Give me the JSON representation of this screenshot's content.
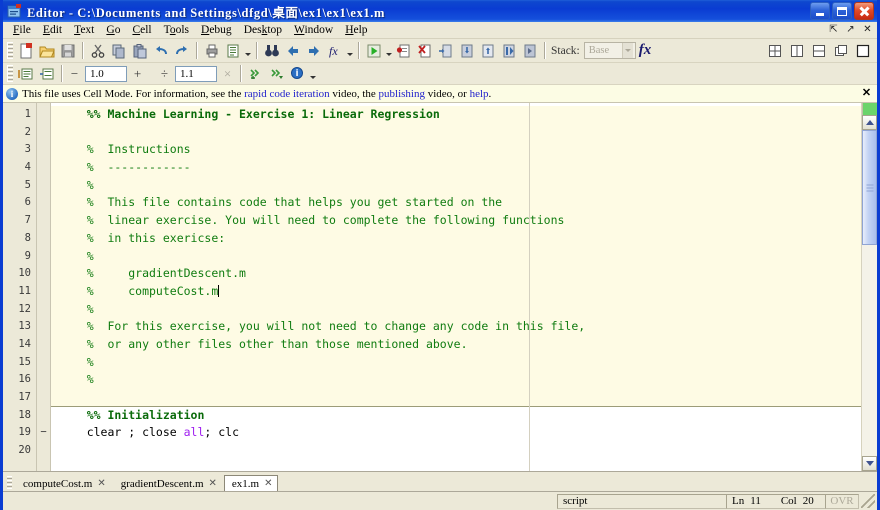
{
  "window": {
    "title": "Editor  -  C:\\Documents and Settings\\dfgd\\桌面\\ex1\\ex1\\ex1.m",
    "icon": "matlab-editor-icon",
    "minimize_label": "Minimize",
    "maximize_label": "Maximize",
    "close_label": "Close"
  },
  "menubar": {
    "items": [
      {
        "label": "File",
        "accel": "F"
      },
      {
        "label": "Edit",
        "accel": "E"
      },
      {
        "label": "Text",
        "accel": "T"
      },
      {
        "label": "Go",
        "accel": "G"
      },
      {
        "label": "Cell",
        "accel": "C"
      },
      {
        "label": "Tools",
        "accel": "o"
      },
      {
        "label": "Debug",
        "accel": "D"
      },
      {
        "label": "Desktop",
        "accel": "k"
      },
      {
        "label": "Window",
        "accel": "W"
      },
      {
        "label": "Help",
        "accel": "H"
      }
    ],
    "right_buttons": [
      {
        "name": "undock-icon",
        "glyph": "⇱"
      },
      {
        "name": "maximize-pane-icon",
        "glyph": "↗"
      },
      {
        "name": "close-pane-icon",
        "glyph": "✕"
      }
    ]
  },
  "toolbar": {
    "buttons": [
      {
        "name": "new-file-button",
        "icon": "new-document-icon"
      },
      {
        "name": "open-file-button",
        "icon": "open-folder-icon"
      },
      {
        "name": "save-file-button",
        "icon": "save-disk-icon"
      },
      {
        "name": "cut-button",
        "icon": "scissors-icon"
      },
      {
        "name": "copy-button",
        "icon": "copy-icon"
      },
      {
        "name": "paste-button",
        "icon": "paste-icon"
      },
      {
        "name": "undo-button",
        "icon": "undo-arrow-icon"
      },
      {
        "name": "redo-button",
        "icon": "redo-arrow-icon"
      },
      {
        "name": "print-button",
        "icon": "printer-icon"
      },
      {
        "name": "publish-button",
        "icon": "publish-page-icon"
      },
      {
        "name": "find-button",
        "icon": "binoculars-icon"
      },
      {
        "name": "back-button",
        "icon": "left-arrow-icon"
      },
      {
        "name": "forward-button",
        "icon": "right-arrow-icon"
      },
      {
        "name": "function-browser-button",
        "icon": "fx-icon"
      },
      {
        "name": "run-button",
        "icon": "green-play-icon"
      },
      {
        "name": "set-breakpoint-button",
        "icon": "breakpoint-icon"
      },
      {
        "name": "clear-breakpoints-button",
        "icon": "clear-breakpoint-icon"
      },
      {
        "name": "step-button",
        "icon": "step-icon"
      },
      {
        "name": "step-in-button",
        "icon": "step-in-icon"
      },
      {
        "name": "step-out-button",
        "icon": "step-out-icon"
      },
      {
        "name": "continue-button",
        "icon": "continue-icon"
      },
      {
        "name": "exit-debug-button",
        "icon": "exit-debug-icon"
      }
    ],
    "stack_label": "Stack:",
    "stack_value": "Base",
    "fx_label": "fx",
    "layout_buttons": [
      {
        "name": "tile-grid-button",
        "icon": "tile-grid-icon"
      },
      {
        "name": "tile-vertical-button",
        "icon": "tile-vertical-icon"
      },
      {
        "name": "tile-horizontal-button",
        "icon": "tile-horizontal-icon"
      },
      {
        "name": "float-button",
        "icon": "float-window-icon"
      },
      {
        "name": "single-pane-button",
        "icon": "single-pane-icon"
      }
    ]
  },
  "cell_toolbar": {
    "buttons": [
      {
        "name": "insert-cell-button",
        "icon": "insert-cell-icon"
      },
      {
        "name": "insert-cell-divider-button",
        "icon": "cell-divider-icon"
      },
      {
        "name": "evaluate-prev-cell-button",
        "icon": "eval-prev-cell-icon"
      },
      {
        "name": "evaluate-next-cell-button",
        "icon": "eval-next-cell-icon"
      },
      {
        "name": "cell-help-button",
        "icon": "info-circle-icon"
      }
    ],
    "decrement_label": "−",
    "increment_label": "+",
    "divide_label": "÷",
    "multiply_label": "×",
    "value_additive": "1.0",
    "value_multiplicative": "1.1"
  },
  "infobar": {
    "icon": "info-circle-icon",
    "prefix": "This file uses Cell Mode. For information, see the ",
    "link1": "rapid code iteration",
    "mid1": " video, the ",
    "link2": "publishing",
    "mid2": " video, or ",
    "link3": "help",
    "suffix": ".",
    "close_label": "✕"
  },
  "editor": {
    "column_marker_column": 75,
    "cursor": {
      "line": 11,
      "column": 20
    },
    "lines": [
      {
        "n": "1",
        "bp": "",
        "cell": true,
        "segments": [
          {
            "t": "    %% Machine Learning - Exercise 1: Linear Regression",
            "c": "cellhdr"
          }
        ]
      },
      {
        "n": "2",
        "bp": "",
        "cell": true,
        "segments": [
          {
            "t": "",
            "c": "cmt"
          }
        ]
      },
      {
        "n": "3",
        "bp": "",
        "cell": true,
        "segments": [
          {
            "t": "    %  Instructions",
            "c": "cmt"
          }
        ]
      },
      {
        "n": "4",
        "bp": "",
        "cell": true,
        "segments": [
          {
            "t": "    %  ------------",
            "c": "cmt"
          }
        ]
      },
      {
        "n": "5",
        "bp": "",
        "cell": true,
        "segments": [
          {
            "t": "    %",
            "c": "cmt"
          }
        ]
      },
      {
        "n": "6",
        "bp": "",
        "cell": true,
        "segments": [
          {
            "t": "    %  This file contains code that helps you get started on the",
            "c": "cmt"
          }
        ]
      },
      {
        "n": "7",
        "bp": "",
        "cell": true,
        "segments": [
          {
            "t": "    %  linear exercise. You will need to complete the following functions",
            "c": "cmt"
          }
        ]
      },
      {
        "n": "8",
        "bp": "",
        "cell": true,
        "segments": [
          {
            "t": "    %  in this exericse:",
            "c": "cmt"
          }
        ]
      },
      {
        "n": "9",
        "bp": "",
        "cell": true,
        "segments": [
          {
            "t": "    %",
            "c": "cmt"
          }
        ]
      },
      {
        "n": "10",
        "bp": "",
        "cell": true,
        "segments": [
          {
            "t": "    %     gradientDescent.m",
            "c": "cmt"
          }
        ]
      },
      {
        "n": "11",
        "bp": "",
        "cell": true,
        "caret": true,
        "segments": [
          {
            "t": "    %     computeCost.m",
            "c": "cmt"
          }
        ]
      },
      {
        "n": "12",
        "bp": "",
        "cell": true,
        "segments": [
          {
            "t": "    %",
            "c": "cmt"
          }
        ]
      },
      {
        "n": "13",
        "bp": "",
        "cell": true,
        "segments": [
          {
            "t": "    %  For this exercise, you will not need to change any code in this file,",
            "c": "cmt"
          }
        ]
      },
      {
        "n": "14",
        "bp": "",
        "cell": true,
        "segments": [
          {
            "t": "    %  or any other files other than those mentioned above.",
            "c": "cmt"
          }
        ]
      },
      {
        "n": "15",
        "bp": "",
        "cell": true,
        "segments": [
          {
            "t": "    %",
            "c": "cmt"
          }
        ]
      },
      {
        "n": "16",
        "bp": "",
        "cell": true,
        "segments": [
          {
            "t": "    %",
            "c": "cmt"
          }
        ]
      },
      {
        "n": "17",
        "bp": "",
        "cell": true,
        "segments": [
          {
            "t": "",
            "c": "cmt"
          }
        ]
      },
      {
        "n": "18",
        "bp": "",
        "cell": false,
        "segments": [
          {
            "t": "    %% Initialization",
            "c": "cellhdr"
          }
        ]
      },
      {
        "n": "19",
        "bp": "−",
        "cell": false,
        "segments": [
          {
            "t": "    clear ; close ",
            "c": ""
          },
          {
            "t": "all",
            "c": "kw"
          },
          {
            "t": "; clc",
            "c": ""
          }
        ]
      },
      {
        "n": "20",
        "bp": "",
        "cell": false,
        "segments": [
          {
            "t": "",
            "c": ""
          }
        ]
      }
    ]
  },
  "tabs": [
    {
      "label": "computeCost.m",
      "active": false,
      "close": "✕"
    },
    {
      "label": "gradientDescent.m",
      "active": false,
      "close": "✕"
    },
    {
      "label": "ex1.m",
      "active": true,
      "close": "✕"
    }
  ],
  "statusbar": {
    "file_type": "script",
    "ln_label": "Ln",
    "ln_value": "11",
    "col_label": "Col",
    "col_value": "20",
    "overwrite_label": "OVR"
  }
}
